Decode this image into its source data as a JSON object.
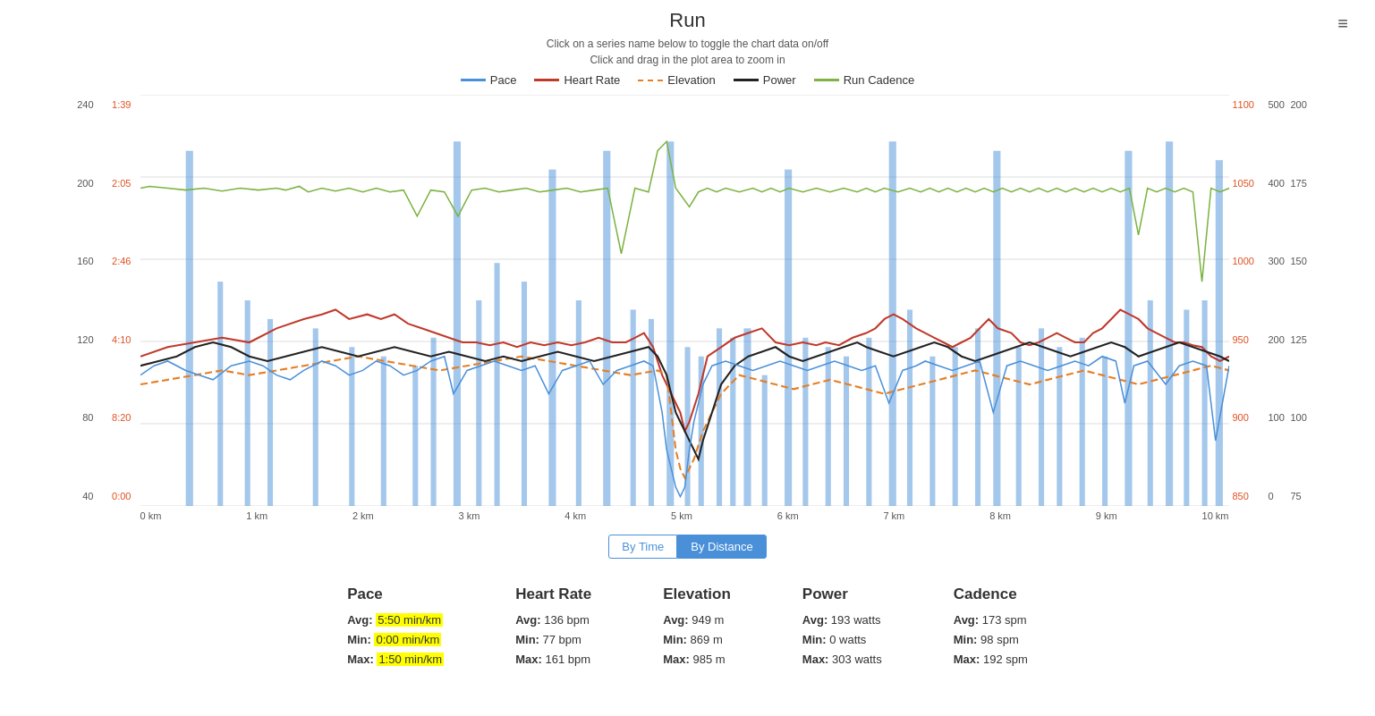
{
  "title": "Run",
  "hints": {
    "line1": "Click on a series name below to toggle the chart data on/off",
    "line2": "Click and drag in the plot area to zoom in"
  },
  "legend": [
    {
      "label": "Pace",
      "color": "#4a90d9",
      "style": "solid"
    },
    {
      "label": "Heart Rate",
      "color": "#c0392b",
      "style": "solid"
    },
    {
      "label": "Elevation",
      "color": "#e67e22",
      "style": "dashed"
    },
    {
      "label": "Power",
      "color": "#222",
      "style": "solid"
    },
    {
      "label": "Run Cadence",
      "color": "#7cb342",
      "style": "solid"
    }
  ],
  "yAxis": {
    "left1": [
      "240",
      "200",
      "160",
      "120",
      "80",
      "40"
    ],
    "left2": [
      "1:39",
      "2:05",
      "2:46",
      "4:10",
      "8:20",
      "0:00"
    ],
    "right1": [
      "1100",
      "1050",
      "1000",
      "950",
      "900",
      "850"
    ],
    "right2": [
      "500",
      "400",
      "300",
      "200",
      "100",
      "0"
    ],
    "right3": [
      "200",
      "175",
      "150",
      "125",
      "100",
      "75"
    ]
  },
  "xAxis": [
    "0 km",
    "1 km",
    "2 km",
    "3 km",
    "4 km",
    "5 km",
    "6 km",
    "7 km",
    "8 km",
    "9 km",
    "10 km"
  ],
  "toggleButtons": [
    {
      "label": "By Time",
      "active": false
    },
    {
      "label": "By Distance",
      "active": true
    }
  ],
  "stats": [
    {
      "title": "Pace",
      "avg": {
        "label": "Avg:",
        "value": "5:50 min/km",
        "highlight": true
      },
      "min": {
        "label": "Min:",
        "value": "0:00 min/km",
        "highlight": true
      },
      "max": {
        "label": "Max:",
        "value": "1:50 min/km",
        "highlight": true
      }
    },
    {
      "title": "Heart Rate",
      "avg": {
        "label": "Avg:",
        "value": "136 bpm"
      },
      "min": {
        "label": "Min:",
        "value": "77 bpm"
      },
      "max": {
        "label": "Max:",
        "value": "161 bpm"
      }
    },
    {
      "title": "Elevation",
      "avg": {
        "label": "Avg:",
        "value": "949 m"
      },
      "min": {
        "label": "Min:",
        "value": "869 m"
      },
      "max": {
        "label": "Max:",
        "value": "985 m"
      }
    },
    {
      "title": "Power",
      "avg": {
        "label": "Avg:",
        "value": "193 watts"
      },
      "min": {
        "label": "Min:",
        "value": "0 watts"
      },
      "max": {
        "label": "Max:",
        "value": "303 watts"
      }
    },
    {
      "title": "Cadence",
      "avg": {
        "label": "Avg:",
        "value": "173 spm"
      },
      "min": {
        "label": "Min:",
        "value": "98 spm"
      },
      "max": {
        "label": "Max:",
        "value": "192 spm"
      }
    }
  ],
  "menuIcon": "≡"
}
